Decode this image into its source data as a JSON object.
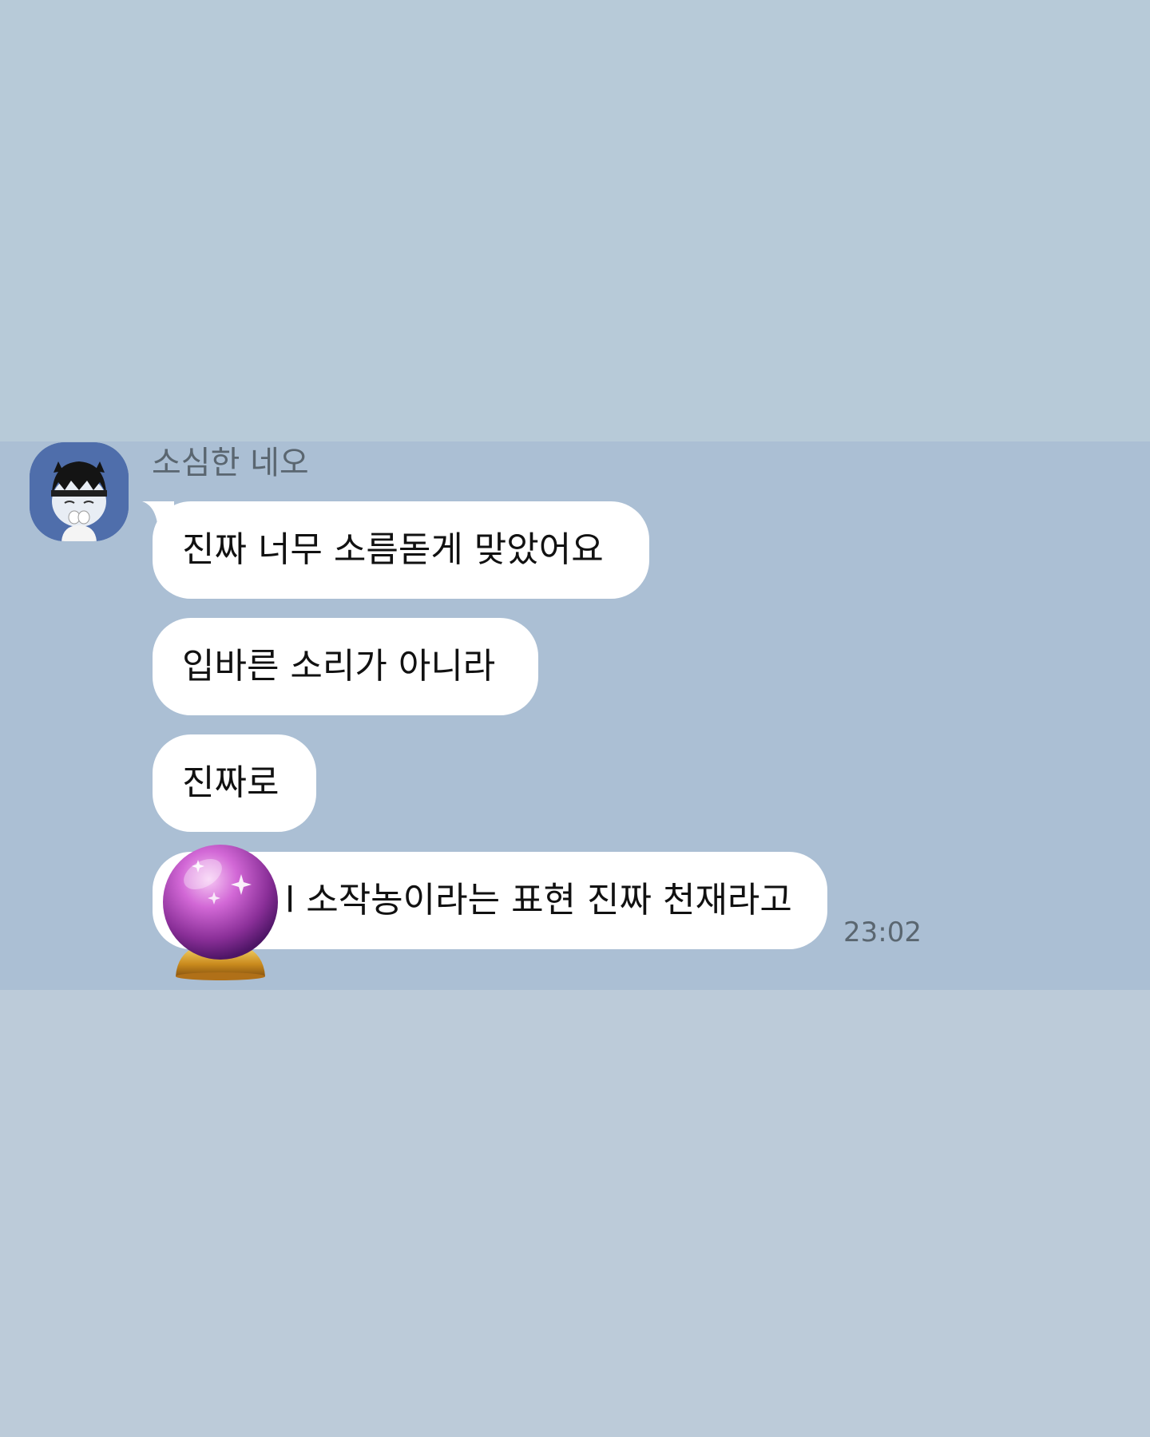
{
  "chat": {
    "sender_name": "소심한 네오",
    "messages": [
      {
        "text": "진짜 너무 소름돋게 맞았어요"
      },
      {
        "text": "입바른 소리가 아니라"
      },
      {
        "text": "진짜로"
      },
      {
        "text": "l 소작농이라는 표현 진짜 천재라고",
        "emoji": "crystal-ball"
      }
    ],
    "timestamp": "23:02"
  },
  "colors": {
    "background_top": "#b7cad8",
    "background_band": "#abbfd4",
    "background_bottom": "#bccbd9",
    "bubble": "#ffffff",
    "avatar_bg": "#4f6eab"
  }
}
